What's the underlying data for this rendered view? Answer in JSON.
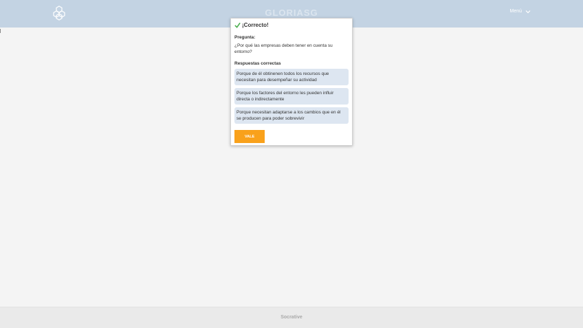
{
  "header": {
    "room_title": "GLORIASG",
    "menu_label": "Menú"
  },
  "modal": {
    "title": "¡Correcto!",
    "question_label": "Pregunta:",
    "question_text": "¿Por qué las empresas deben tener en cuenta su entorno?",
    "answers_label": "Respuestas correctas",
    "answers": [
      "Porque de él obtinenen todos los recursos que necesitan para desempeñar su actividad",
      "Porque los factores del entorno les pueden influir directa o indirectamente",
      "Porque necesitan adaptarse a los cambios que en él se producen para poder sobrevivir"
    ],
    "ok_button_label": "VALE"
  },
  "footer": {
    "brand": "Socrative"
  },
  "colors": {
    "topbar": "#c3d3e3",
    "answer_bg": "#dde6f1",
    "ok_button": "#f9a11b",
    "check": "#4caf50"
  }
}
